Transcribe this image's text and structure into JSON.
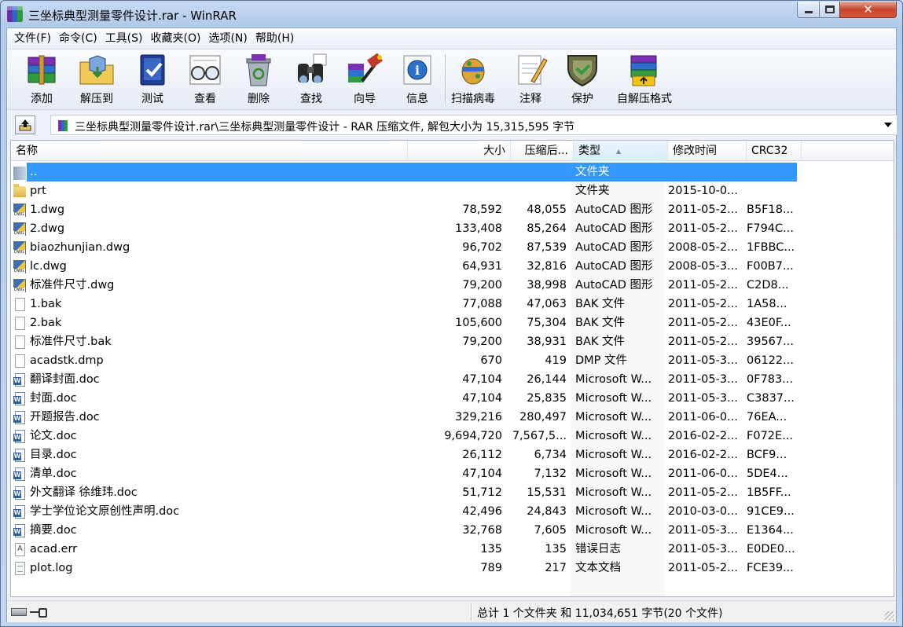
{
  "window": {
    "title": "三坐标典型测量零件设计.rar - WinRAR",
    "icon": "winrar-icon"
  },
  "menu": [
    "文件(F)",
    "命令(C)",
    "工具(S)",
    "收藏夹(O)",
    "选项(N)",
    "帮助(H)"
  ],
  "toolbar": [
    {
      "label": "添加",
      "icon": "archive-add-icon"
    },
    {
      "label": "解压到",
      "icon": "extract-folder-icon"
    },
    {
      "label": "测试",
      "icon": "test-icon"
    },
    {
      "label": "查看",
      "icon": "view-glasses-icon"
    },
    {
      "label": "删除",
      "icon": "delete-bin-icon"
    },
    {
      "label": "查找",
      "icon": "binoculars-icon"
    },
    {
      "label": "向导",
      "icon": "wizard-icon"
    },
    {
      "label": "信息",
      "icon": "info-icon"
    },
    {
      "label": "扫描病毒",
      "icon": "virus-scan-icon"
    },
    {
      "label": "注释",
      "icon": "comment-icon"
    },
    {
      "label": "保护",
      "icon": "protect-shield-icon"
    },
    {
      "label": "自解压格式",
      "icon": "sfx-icon"
    }
  ],
  "address": {
    "path": "三坐标典型测量零件设计.rar\\三坐标典型测量零件设计 - RAR 压缩文件, 解包大小为 15,315,595 字节"
  },
  "columns": {
    "name": "名称",
    "size": "大小",
    "packed": "压缩后...",
    "type": "类型",
    "modified": "修改时间",
    "crc": "CRC32"
  },
  "files": [
    {
      "icon": "up-folder",
      "name": "..",
      "size": "",
      "packed": "",
      "type": "文件夹",
      "modified": "",
      "crc": "",
      "selected": true
    },
    {
      "icon": "folder",
      "name": "prt",
      "size": "",
      "packed": "",
      "type": "文件夹",
      "modified": "2015-10-0...",
      "crc": ""
    },
    {
      "icon": "dwg",
      "name": "1.dwg",
      "size": "78,592",
      "packed": "48,055",
      "type": "AutoCAD 图形",
      "modified": "2011-05-2...",
      "crc": "B5F18..."
    },
    {
      "icon": "dwg",
      "name": "2.dwg",
      "size": "133,408",
      "packed": "85,264",
      "type": "AutoCAD 图形",
      "modified": "2011-05-2...",
      "crc": "F794C..."
    },
    {
      "icon": "dwg",
      "name": "biaozhunjian.dwg",
      "size": "96,702",
      "packed": "87,539",
      "type": "AutoCAD 图形",
      "modified": "2008-05-2...",
      "crc": "1FBBC..."
    },
    {
      "icon": "dwg",
      "name": "lc.dwg",
      "size": "64,931",
      "packed": "32,816",
      "type": "AutoCAD 图形",
      "modified": "2008-05-3...",
      "crc": "F00B7..."
    },
    {
      "icon": "dwg",
      "name": "标准件尺寸.dwg",
      "size": "79,200",
      "packed": "38,998",
      "type": "AutoCAD 图形",
      "modified": "2011-05-2...",
      "crc": "C2D8..."
    },
    {
      "icon": "file",
      "name": "1.bak",
      "size": "77,088",
      "packed": "47,063",
      "type": "BAK 文件",
      "modified": "2011-05-2...",
      "crc": "1A58..."
    },
    {
      "icon": "file",
      "name": "2.bak",
      "size": "105,600",
      "packed": "75,304",
      "type": "BAK 文件",
      "modified": "2011-05-2...",
      "crc": "43E0F..."
    },
    {
      "icon": "file",
      "name": "标准件尺寸.bak",
      "size": "79,200",
      "packed": "38,931",
      "type": "BAK 文件",
      "modified": "2011-05-2...",
      "crc": "39567..."
    },
    {
      "icon": "file",
      "name": "acadstk.dmp",
      "size": "670",
      "packed": "419",
      "type": "DMP 文件",
      "modified": "2011-05-3...",
      "crc": "06122..."
    },
    {
      "icon": "doc",
      "name": "翻译封面.doc",
      "size": "47,104",
      "packed": "26,144",
      "type": "Microsoft W...",
      "modified": "2011-05-3...",
      "crc": "0F783..."
    },
    {
      "icon": "doc",
      "name": "封面.doc",
      "size": "47,104",
      "packed": "25,835",
      "type": "Microsoft W...",
      "modified": "2011-05-3...",
      "crc": "C3837..."
    },
    {
      "icon": "doc",
      "name": "开题报告.doc",
      "size": "329,216",
      "packed": "280,497",
      "type": "Microsoft W...",
      "modified": "2011-06-0...",
      "crc": "76EA..."
    },
    {
      "icon": "doc",
      "name": "论文.doc",
      "size": "9,694,720",
      "packed": "7,567,5...",
      "type": "Microsoft W...",
      "modified": "2016-02-2...",
      "crc": "F072E..."
    },
    {
      "icon": "doc",
      "name": "目录.doc",
      "size": "26,112",
      "packed": "6,734",
      "type": "Microsoft W...",
      "modified": "2016-02-2...",
      "crc": "BCF9..."
    },
    {
      "icon": "doc",
      "name": "清单.doc",
      "size": "47,104",
      "packed": "7,132",
      "type": "Microsoft W...",
      "modified": "2011-06-0...",
      "crc": "5DE4..."
    },
    {
      "icon": "doc",
      "name": "外文翻译 徐维玮.doc",
      "size": "51,712",
      "packed": "15,531",
      "type": "Microsoft W...",
      "modified": "2011-05-2...",
      "crc": "1B5FF..."
    },
    {
      "icon": "doc",
      "name": "学士学位论文原创性声明.doc",
      "size": "42,496",
      "packed": "24,843",
      "type": "Microsoft W...",
      "modified": "2010-03-0...",
      "crc": "91CE9..."
    },
    {
      "icon": "doc",
      "name": "摘要.doc",
      "size": "32,768",
      "packed": "7,605",
      "type": "Microsoft W...",
      "modified": "2011-05-3...",
      "crc": "E1364..."
    },
    {
      "icon": "err",
      "name": "acad.err",
      "size": "135",
      "packed": "135",
      "type": "错误日志",
      "modified": "2011-05-3...",
      "crc": "E0DE0..."
    },
    {
      "icon": "log",
      "name": "plot.log",
      "size": "789",
      "packed": "217",
      "type": "文本文档",
      "modified": "2011-05-2...",
      "crc": "FCE39..."
    }
  ],
  "status": {
    "text": "总计 1 个文件夹 和 11,034,651 字节(20 个文件)"
  }
}
